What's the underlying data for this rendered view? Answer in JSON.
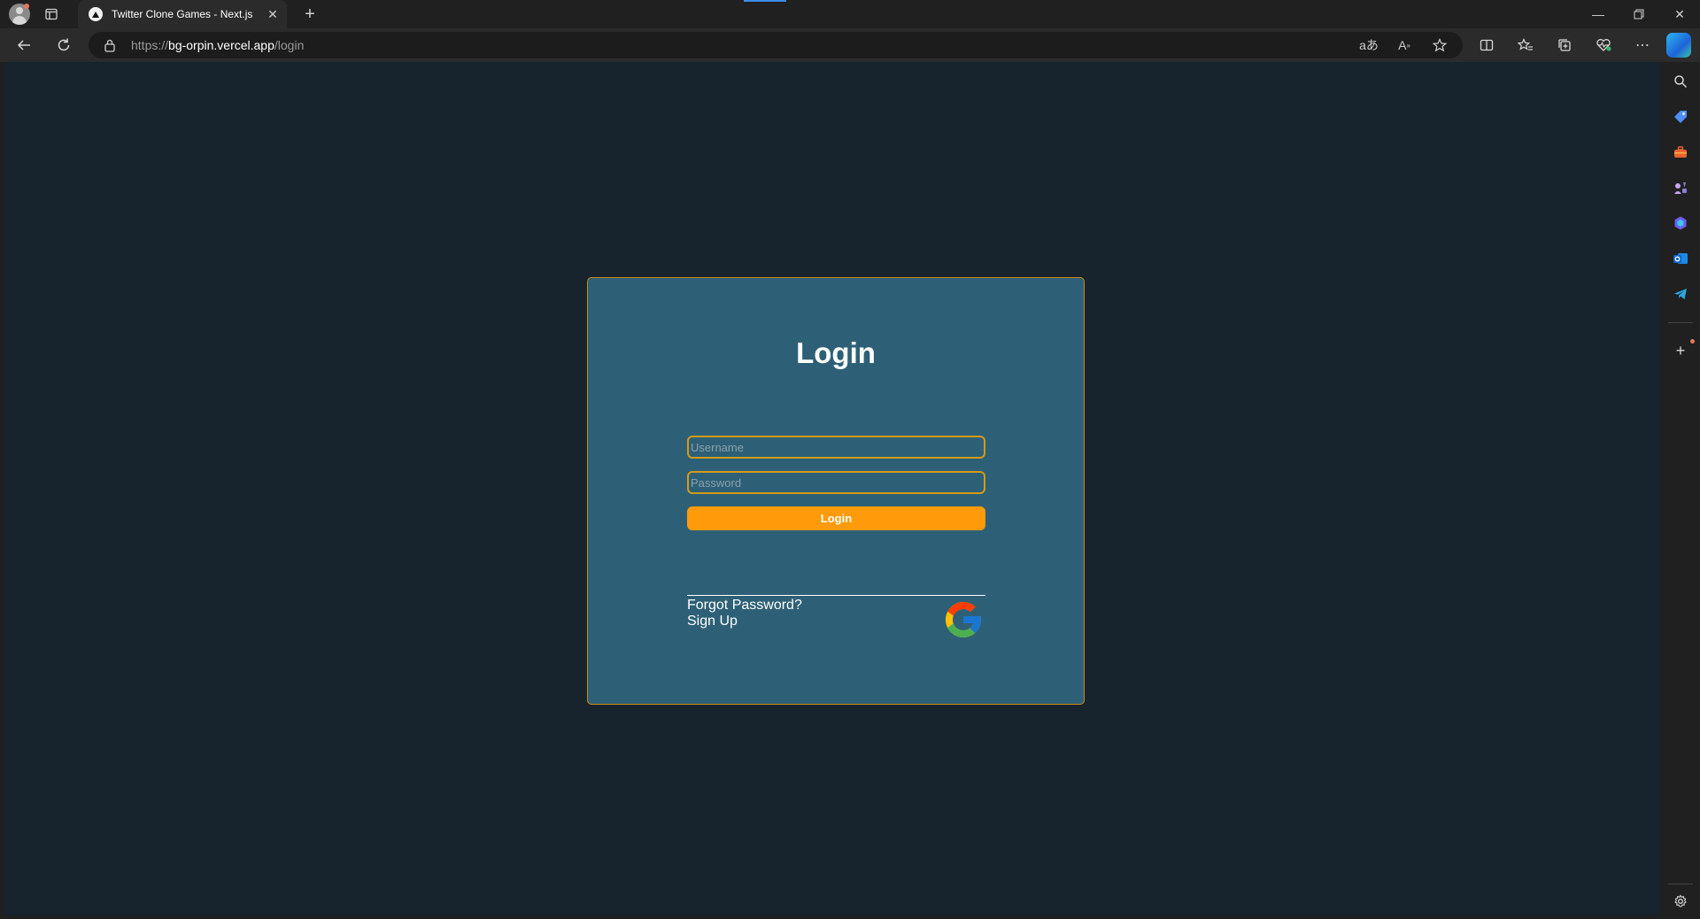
{
  "browser": {
    "tab_title": "Twitter Clone Games - Next.js",
    "url_scheme": "https://",
    "url_host": "bg-orpin.vercel.app",
    "url_path": "/login",
    "icons": {
      "profile": "profile-avatar-icon",
      "tab_actions": "tab-actions-icon",
      "favicon": "vercel-triangle-icon",
      "close_tab": "close-icon",
      "new_tab": "plus-icon",
      "back": "back-arrow-icon",
      "refresh": "refresh-icon",
      "lock": "lock-icon",
      "read_aloud_translate": "translate-icon",
      "read_aloud": "read-aloud-icon",
      "favorite": "star-icon",
      "split_screen": "split-screen-icon",
      "favorites": "favorites-icon",
      "collections": "collections-icon",
      "health": "browser-essentials-icon",
      "more": "more-icon",
      "copilot": "copilot-icon"
    }
  },
  "sidebar": {
    "items": [
      "search-icon",
      "shopping-tag-icon",
      "tools-icon",
      "games-icon",
      "copilot-app-icon",
      "outlook-icon",
      "telegram-icon",
      "add-icon",
      "settings-icon"
    ]
  },
  "login": {
    "title": "Login",
    "username_placeholder": "Username",
    "password_placeholder": "Password",
    "login_button": "Login",
    "forgot_password": "Forgot Password?",
    "sign_up": "Sign Up"
  },
  "colors": {
    "page_bg": "#17232d",
    "card_bg": "#2d6076",
    "accent": "#ff9a0a",
    "border": "#d39a1a"
  }
}
